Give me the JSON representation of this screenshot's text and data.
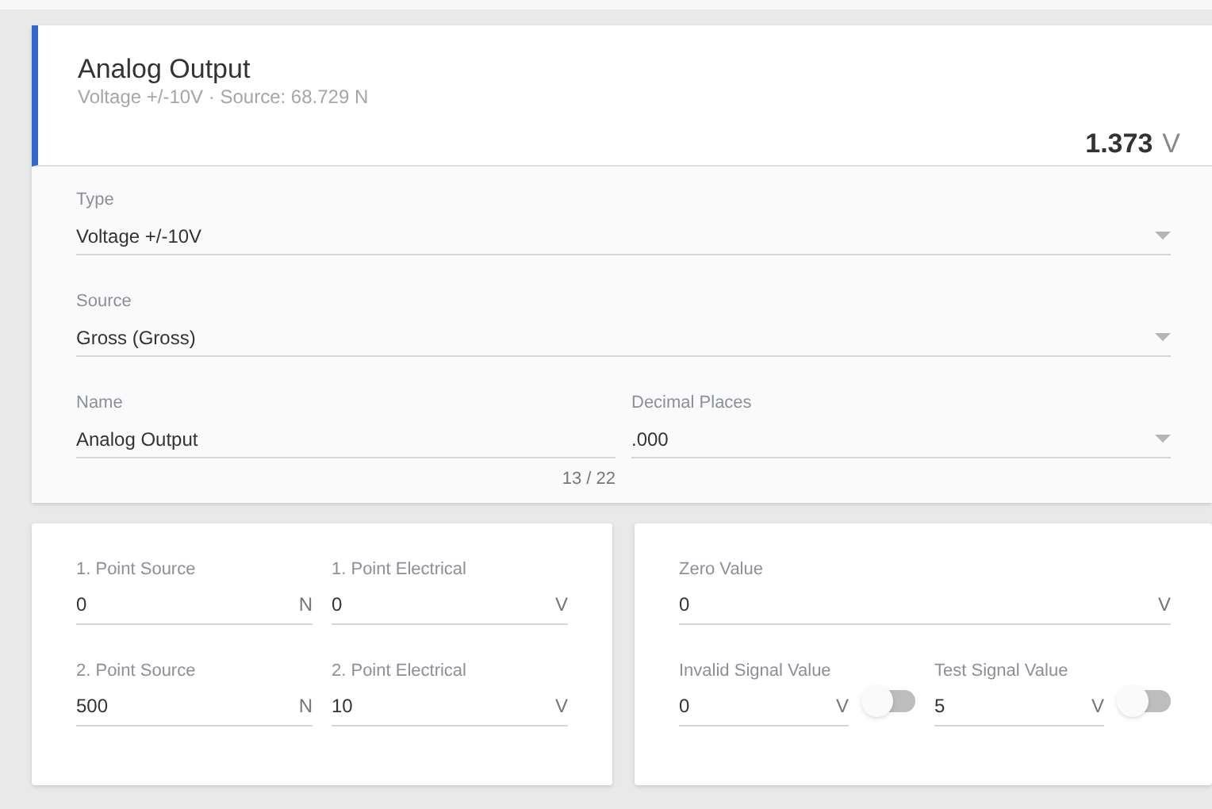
{
  "header": {
    "title": "Analog Output",
    "subtitle": "Voltage +/-10V · Source:  68.729 N",
    "reading": "1.373",
    "reading_unit": "V"
  },
  "settings": [
    [
      {
        "kind": "select",
        "label": "Type",
        "value": "Voltage +/-10V"
      }
    ],
    [
      {
        "kind": "select",
        "label": "Source",
        "value": "Gross (Gross)"
      }
    ],
    [
      {
        "kind": "text",
        "label": "Name",
        "value": "Analog Output",
        "counter": "13 / 22"
      },
      {
        "kind": "select",
        "label": "Decimal Places",
        "value": ".000"
      }
    ]
  ],
  "calibration": [
    [
      {
        "label": "1. Point Source",
        "value": "0",
        "unit": "N"
      },
      {
        "label": "1. Point Electrical",
        "value": "0",
        "unit": "V"
      }
    ],
    [
      {
        "label": "2. Point Source",
        "value": "500",
        "unit": "N"
      },
      {
        "label": "2. Point Electrical",
        "value": "10",
        "unit": "V"
      }
    ]
  ],
  "signals": [
    [
      {
        "label": "Zero Value",
        "value": "0",
        "unit": "V"
      }
    ],
    [
      {
        "label": "Invalid Signal Value",
        "value": "0",
        "unit": "V",
        "on": false
      },
      {
        "label": "Test Signal Value",
        "value": "5",
        "unit": "V",
        "on": false
      }
    ]
  ]
}
